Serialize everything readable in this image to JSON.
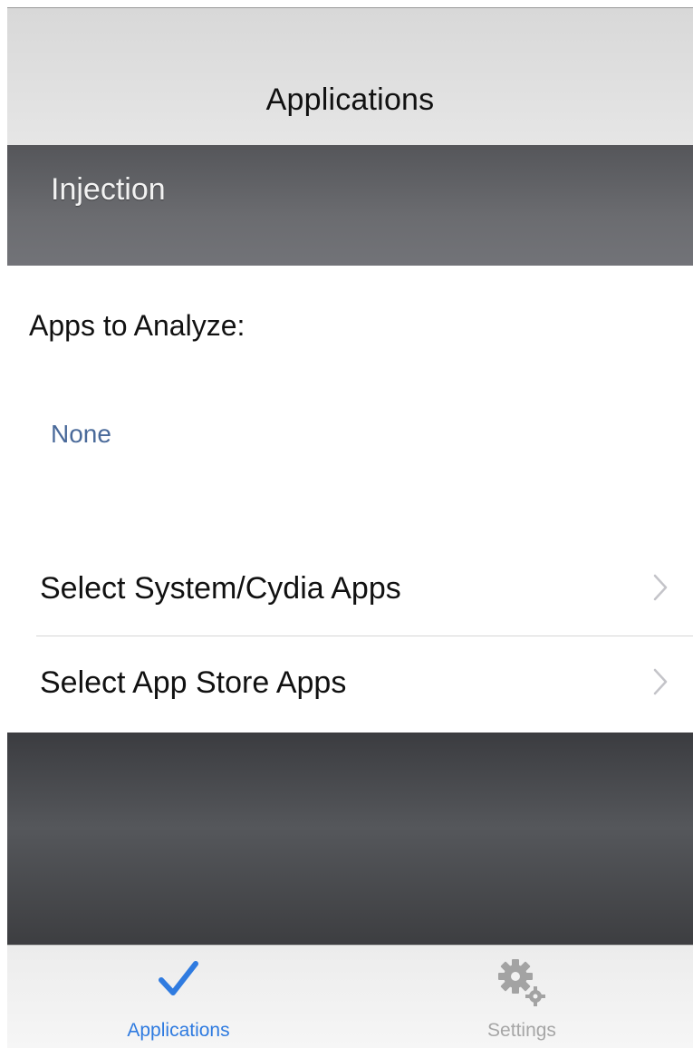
{
  "navbar": {
    "title": "Applications"
  },
  "section_header": {
    "label": "Injection"
  },
  "content": {
    "analyze_label": "Apps to Analyze:",
    "selected_apps_value": "None",
    "rows": [
      {
        "label": "Select System/Cydia Apps",
        "icon": "chevron-right-icon"
      },
      {
        "label": "Select App Store Apps",
        "icon": "chevron-right-icon"
      }
    ]
  },
  "tabbar": {
    "tabs": [
      {
        "label": "Applications",
        "icon": "checkmark-icon",
        "selected": true
      },
      {
        "label": "Settings",
        "icon": "gears-icon",
        "selected": false
      }
    ]
  },
  "colors": {
    "accent": "#2f7be0",
    "inactive_tab": "#a6a6a6",
    "section_header_bg": "#66676b",
    "value_text": "#4a6a9a"
  }
}
